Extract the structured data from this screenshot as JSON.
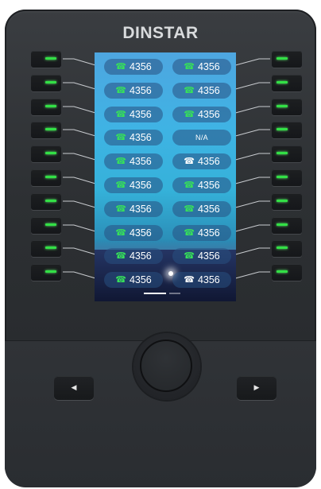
{
  "device": {
    "brand": "DINSTAR",
    "led_color": "#33e046"
  },
  "screen": {
    "left_column": [
      {
        "icon": "phone-icon",
        "label": "4356",
        "state": "green"
      },
      {
        "icon": "phone-icon",
        "label": "4356",
        "state": "green"
      },
      {
        "icon": "phone-icon",
        "label": "4356",
        "state": "green"
      },
      {
        "icon": "phone-icon",
        "label": "4356",
        "state": "green"
      },
      {
        "icon": "phone-icon",
        "label": "4356",
        "state": "green"
      },
      {
        "icon": "phone-icon",
        "label": "4356",
        "state": "green"
      },
      {
        "icon": "phone-icon",
        "label": "4356",
        "state": "green"
      },
      {
        "icon": "phone-icon",
        "label": "4356",
        "state": "green"
      },
      {
        "icon": "phone-icon",
        "label": "4356",
        "state": "green"
      },
      {
        "icon": "phone-icon",
        "label": "4356",
        "state": "green"
      }
    ],
    "right_column": [
      {
        "icon": "phone-icon",
        "label": "4356",
        "state": "green"
      },
      {
        "icon": "phone-icon",
        "label": "4356",
        "state": "green"
      },
      {
        "icon": "phone-icon",
        "label": "4356",
        "state": "green"
      },
      {
        "icon": "",
        "label": "N/A",
        "state": "na"
      },
      {
        "icon": "phone-icon",
        "label": "4356",
        "state": "white"
      },
      {
        "icon": "phone-icon",
        "label": "4356",
        "state": "green"
      },
      {
        "icon": "phone-icon",
        "label": "4356",
        "state": "green"
      },
      {
        "icon": "phone-icon",
        "label": "4356",
        "state": "green"
      },
      {
        "icon": "phone-icon",
        "label": "4356",
        "state": "green"
      },
      {
        "icon": "phone-icon",
        "label": "4356",
        "state": "white"
      }
    ]
  },
  "navigation": {
    "left_icon": "left-arrow-icon",
    "right_icon": "right-arrow-icon",
    "center_icon": "center-button"
  }
}
